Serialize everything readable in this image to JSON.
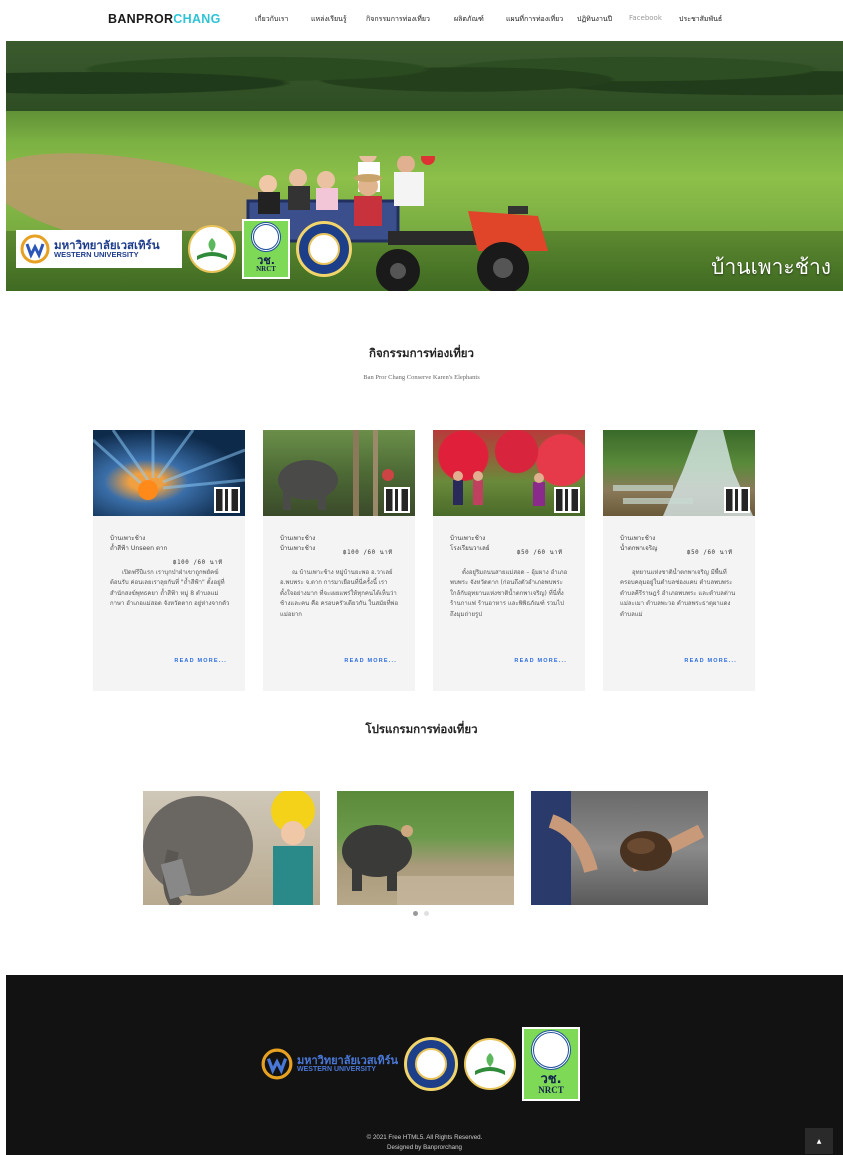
{
  "nav": {
    "brand_main": "BANPROR",
    "brand_accent": "CHANG",
    "items": [
      {
        "label": "เกี่ยวกับเรา"
      },
      {
        "label": "แหล่งเรียนรู้"
      },
      {
        "label": "กิจกรรมการท่องเที่ยว"
      },
      {
        "label": "ผลิตภัณฑ์"
      },
      {
        "label": "แผนที่การท่องเที่ยว"
      },
      {
        "label": "ปฏิทินงานปี"
      },
      {
        "label": "Facebook"
      },
      {
        "label": "ประชาสัมพันธ์"
      }
    ]
  },
  "hero": {
    "title": "บ้านเพาะช้าง",
    "wu_logo_th": "มหาวิทยาลัยเวสเทิร์น",
    "wu_logo_en": "WESTERN UNIVERSITY",
    "nrct_th": "วช.",
    "nrct_en": "NRCT"
  },
  "activities": {
    "title": "กิจกรรมการท่องเที่ยว",
    "subtitle": "Ban Pror Chang Conserve Karen's Elephants",
    "cards": [
      {
        "village": "บ้านเพาะช้าง",
        "place": "ถ้ำสีฟ้า Unseen ตาก",
        "price": "฿100 /60 นาที",
        "text": "เปิดฟรีปีแรก เราบุกป่าฝ่าเขาถูกพยัคฆ์ต้อนรับ ค่อนเลยเราลุยกันที่ \"ถ้ำสีฟ้า\" ตั้งอยู่ที่สำนักสงฆ์พุทธคยา ถ้ำสีฟ้า หมู่ 8 ตำบลแม่กาษา อำเภอแม่สอด จังหวัดตาก อยู่ห่างจากตัว",
        "more": "READ MORE..."
      },
      {
        "village": "บ้านเพาะช้าง",
        "place": "บ้านเพาะช้าง",
        "price": "฿100 /60 นาที",
        "text": "ณ บ้านเพาะช้าง หมู่บ้านยะพอ อ.วาเลย์ อ.พบพระ จ.ตาก การมาเยือนที่นี่ครั้งนี้ เราตั้งใจอย่างมาก ที่จะเผยแพร่ให้ทุกคนได้เห็นว่า ช้างและคน คือ ครอบครัวเดียวกัน ในสมัยที่พ่อแม่อยาก",
        "more": "READ MORE..."
      },
      {
        "village": "บ้านเพาะช้าง",
        "place": "โรงเรียนวาเลย์",
        "price": "฿50 /60 นาที",
        "text": "ตั้งอยู่ริมถนนสายแม่สอด – อุ้มผาง อำเภอพบพระ จังหวัดตาก (ก่อนถึงตัวอำเภอพบพระ ใกล้กับอุทยานแห่งชาติน้ำตกพาเจริญ) ที่นี่ทั้ง ร้านกาแฟ ร้านอาหาร และพิพิธภัณฑ์ รวมไปถึงมุมถ่ายรูป",
        "more": "READ MORE..."
      },
      {
        "village": "บ้านเพาะช้าง",
        "place": "น้ำตกพาเจริญ",
        "price": "฿50 /60 นาที",
        "text": "อุทยานแห่งชาติน้ำตกพาเจริญ มีพื้นที่ครอบคลุมอยู่ในตำบลช่องแคบ ตำบลพบพระ ตำบลคีรีราษฎร์ อำเภอพบพระ และตำบลด่านแม่ละเมา ตำบลพะวอ ตำบลพระธาตุผาแดง ตำบลแม่",
        "more": "READ MORE..."
      }
    ]
  },
  "programs": {
    "title": "โปรแกรมการท่องเที่ยว",
    "slides": [
      "elephant-selfie",
      "elephant-river",
      "elephant-dung"
    ],
    "active_dot": 1,
    "dot_count": 2
  },
  "footer": {
    "wu_th": "มหาวิทยาลัยเวสเทิร์น",
    "wu_en": "WESTERN UNIVERSITY",
    "nrct_th": "วช.",
    "nrct_en": "NRCT",
    "copyright": "© 2021 Free HTML5. All Rights Reserved.",
    "designed": "Designed by Banprorchang",
    "to_top": "▲"
  }
}
